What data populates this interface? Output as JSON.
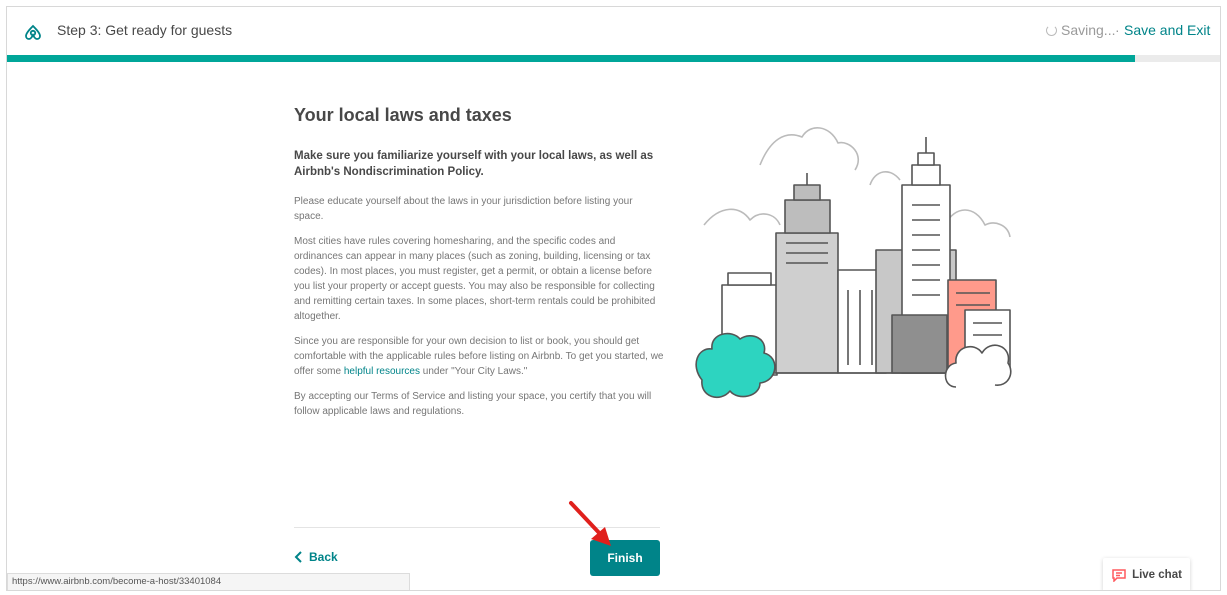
{
  "header": {
    "step_title": "Step 3: Get ready for guests",
    "saving_text": "Saving...",
    "separator": "·",
    "save_exit_label": "Save and Exit",
    "progress_fraction": 0.93
  },
  "main": {
    "heading": "Your local laws and taxes",
    "lead": "Make sure you familiarize yourself with your local laws, as well as Airbnb's Nondiscrimination Policy.",
    "para1": "Please educate yourself about the laws in your jurisdiction before listing your space.",
    "para2": "Most cities have rules covering homesharing, and the specific codes and ordinances can appear in many places (such as zoning, building, licensing or tax codes). In most places, you must register, get a permit, or obtain a license before you list your property or accept guests. You may also be responsible for collecting and remitting certain taxes. In some places, short-term rentals could be prohibited altogether.",
    "para3_before": "Since you are responsible for your own decision to list or book, you should get comfortable with the applicable rules before listing on Airbnb. To get you started, we offer some ",
    "para3_link": "helpful resources",
    "para3_after": " under \"Your City Laws.\"",
    "para4": "By accepting our Terms of Service and listing your space, you certify that you will follow applicable laws and regulations."
  },
  "footer": {
    "back_label": "Back",
    "finish_label": "Finish"
  },
  "status_bar": {
    "url": "https://www.airbnb.com/become-a-host/33401084"
  },
  "live_chat": {
    "label": "Live chat"
  },
  "colors": {
    "accent": "#008489",
    "progress": "#00a699",
    "brand": "#ff5a5f",
    "tree": "#2dd4c0",
    "arrow": "#e0201c"
  }
}
